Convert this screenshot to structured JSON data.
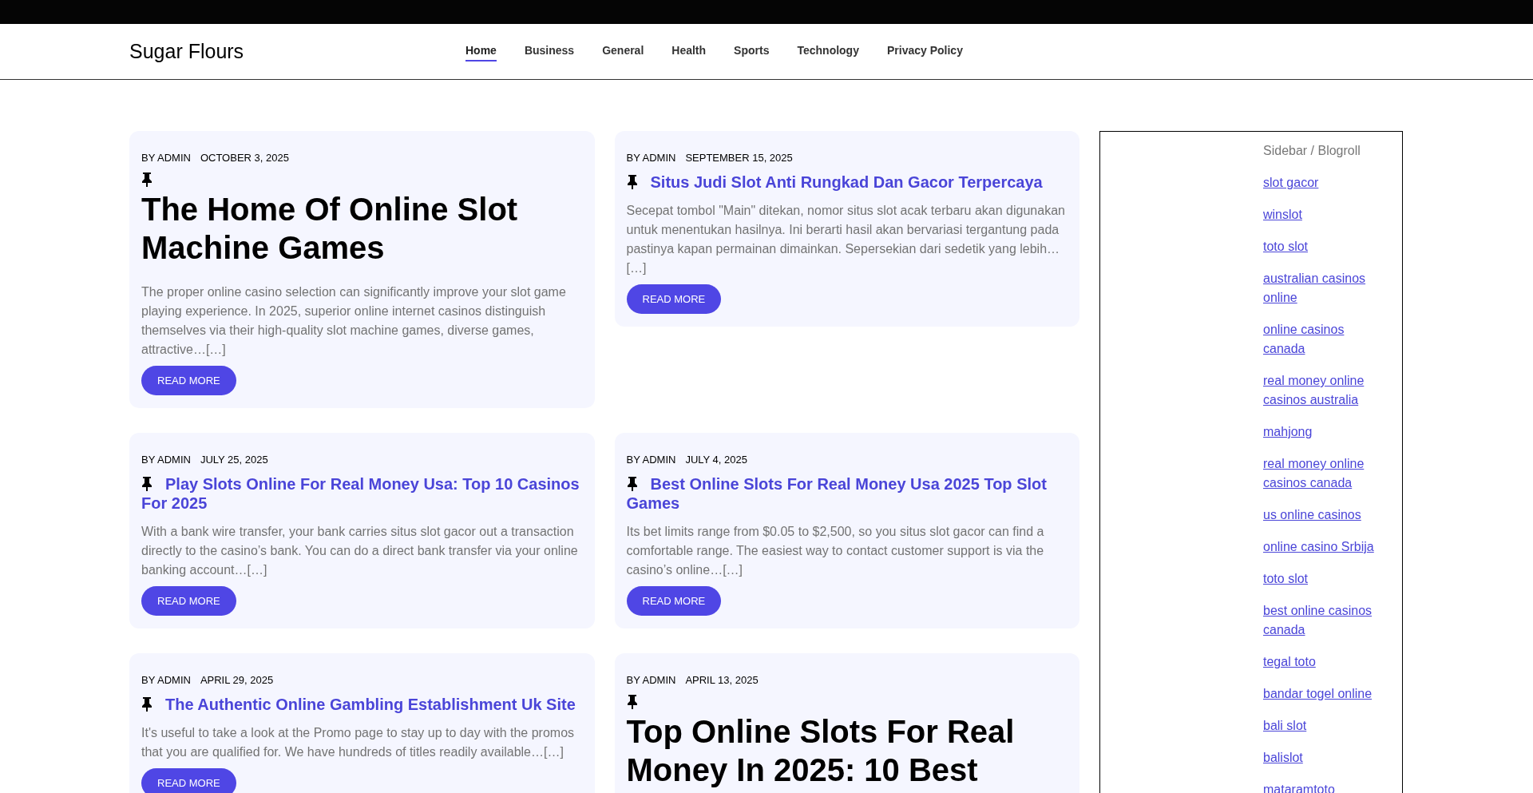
{
  "site": {
    "title": "Sugar Flours"
  },
  "nav": [
    {
      "label": "Home",
      "selected": true
    },
    {
      "label": "Business",
      "selected": false
    },
    {
      "label": "General",
      "selected": false
    },
    {
      "label": "Health",
      "selected": false
    },
    {
      "label": "Sports",
      "selected": false
    },
    {
      "label": "Technology",
      "selected": false
    },
    {
      "label": "Privacy Policy",
      "selected": false
    }
  ],
  "posts": [
    {
      "kind": "featured",
      "author": "BY ADMIN",
      "date": "OCTOBER 3, 2025",
      "title": "The Home Of Online Slot Machine Games",
      "excerpt": "The proper online casino selection can significantly improve your slot game playing experience. In 2025, superior online internet casinos distinguish themselves via their high-quality slot machine games, diverse games, attractive…[…]",
      "button": "READ MORE"
    },
    {
      "kind": "normal",
      "author": "BY ADMIN",
      "date": "SEPTEMBER 15, 2025",
      "title": "Situs Judi Slot Anti Rungkad Dan Gacor Terpercaya",
      "excerpt": "Secepat tombol \"Main\" ditekan, nomor situs slot acak terbaru akan digunakan untuk menentukan hasilnya. Ini berarti hasil akan bervariasi tergantung pada pastinya kapan permainan dimainkan. Sepersekian dari sedetik yang lebih…[…]",
      "button": "READ MORE"
    },
    {
      "kind": "normal",
      "author": "BY ADMIN",
      "date": "JULY 25, 2025",
      "title": "Play Slots Online For Real Money Usa: Top 10 Casinos For 2025",
      "excerpt": "With a bank wire transfer, your bank carries situs slot gacor out a transaction directly to the casino’s bank. You can do a direct bank transfer via your online banking account…[…]",
      "button": "READ MORE"
    },
    {
      "kind": "normal",
      "author": "BY ADMIN",
      "date": "JULY 4, 2025",
      "title": "Best Online Slots For Real Money Usa 2025 Top Slot Games",
      "excerpt": "Its bet limits range from $0.05 to $2,500, so you situs slot gacor can find a comfortable range. The easiest way to contact customer support is via the casino’s online…[…]",
      "button": "READ MORE"
    },
    {
      "kind": "normal",
      "author": "BY ADMIN",
      "date": "APRIL 29, 2025",
      "title": "The Authentic Online Gambling Establishment Uk Site",
      "excerpt": "It's useful to take a look at the Promo page to stay up to day with the promos that you are qualified for. We have hundreds of titles readily available…[…]",
      "button": "READ MORE"
    },
    {
      "kind": "featured",
      "author": "BY ADMIN",
      "date": "APRIL 13, 2025",
      "title": "Top Online Slots For Real Money In 2025: 10 Best"
    }
  ],
  "sidebar": {
    "title": "Sidebar / Blogroll",
    "links": [
      "slot gacor",
      "winslot",
      "toto slot",
      "australian casinos online",
      "online casinos canada",
      "real money online casinos australia",
      "mahjong",
      "real money online casinos canada",
      "us online casinos",
      "online casino Srbija",
      "toto slot",
      "best online casinos canada",
      "tegal toto",
      "bandar togel online",
      "bali slot",
      "balislot",
      "mataramtoto"
    ]
  }
}
